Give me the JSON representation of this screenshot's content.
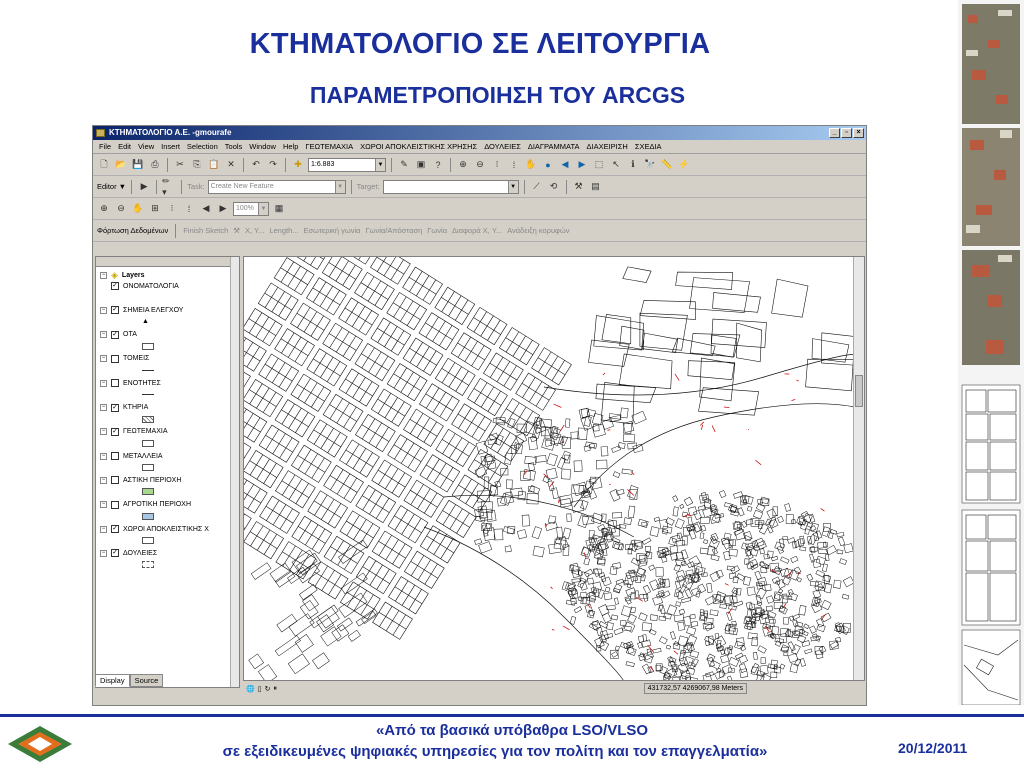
{
  "slide": {
    "title": "ΚΤΗΜΑΤΟΛΟΓΙΟ ΣΕ ΛΕΙΤΟΥΡΓΙΑ",
    "subtitle": "ΠΑΡΑΜΕΤΡΟΠΟΙΗΣΗ ΤΟΥ ARCGS",
    "footer_line1": "«Από τα βασικά υπόβαθρα LSO/VLSO",
    "footer_line2": "σε εξειδικευμένες ψηφιακές υπηρεσίες για τον πολίτη και τον επαγγελματία»",
    "date": "20/12/2011"
  },
  "window": {
    "title": "ΚΤΗΜΑΤΟΛΟΓΙΟ Α.Ε. -gmourafe",
    "menu": [
      "File",
      "Edit",
      "View",
      "Insert",
      "Selection",
      "Tools",
      "Window",
      "Help",
      "ΓΕΩΤΕΜΑΧΙΑ",
      "ΧΩΡΟΙ ΑΠΟΚΛΕΙΣΤΙΚΗΣ ΧΡΗΣΗΣ",
      "ΔΟΥΛΕΙΕΣ",
      "ΔΙΑΓΡΑΜΜΑΤΑ",
      "ΔΙΑΧΕΙΡΙΣΗ",
      "ΣΧΕΔΙΑ"
    ],
    "scale": "1:6.883",
    "editor_label": "Editor ▼",
    "task_label": "Task:",
    "task_value": "Create New Feature",
    "target_label": "Target:",
    "zoom_value": "100%",
    "custom_toolbar": [
      "Φόρτωση Δεδομένων",
      "Finish Sketch",
      "X, Y...",
      "Length...",
      "Εσωτερική γωνία",
      "Γωνία/Απόσταση",
      "Γωνία",
      "Διαφορά X, Y...",
      "Ανάδειξη κορυφών"
    ],
    "layers_root": "Layers",
    "layers": [
      {
        "name": "ΟΝΟΜΑΤΟΛΟΓΙΑ",
        "checked": true,
        "expand": "",
        "symbol": "none"
      },
      {
        "name": "ΣΗΜΕΙΑ ΕΛΕΓΧΟΥ",
        "checked": true,
        "expand": "−",
        "symbol": "triangle"
      },
      {
        "name": "ΟΤΑ",
        "checked": true,
        "expand": "−",
        "symbol": "box"
      },
      {
        "name": "ΤΟΜΕΙΣ",
        "checked": false,
        "expand": "−",
        "symbol": "line"
      },
      {
        "name": "ΕΝΟΤΗΤΕΣ",
        "checked": false,
        "expand": "−",
        "symbol": "line"
      },
      {
        "name": "ΚΤΗΡΙΑ",
        "checked": true,
        "expand": "−",
        "symbol": "hatch"
      },
      {
        "name": "ΓΕΩΤΕΜΑΧΙΑ",
        "checked": true,
        "expand": "−",
        "symbol": "box"
      },
      {
        "name": "ΜΕΤΑΛΛΕΙΑ",
        "checked": false,
        "expand": "−",
        "symbol": "box"
      },
      {
        "name": "ΑΣΤΙΚΗ ΠΕΡΙΟΧΗ",
        "checked": false,
        "expand": "−",
        "symbol": "green"
      },
      {
        "name": "ΑΓΡΟΤΙΚΗ ΠΕΡΙΟΧΗ",
        "checked": false,
        "expand": "−",
        "symbol": "blue"
      },
      {
        "name": "ΧΩΡΟΙ ΑΠΟΚΛΕΙΣΤΙΚΗΣ Χ",
        "checked": true,
        "expand": "−",
        "symbol": "box"
      },
      {
        "name": "ΔΟΥΛΕΙΕΣ",
        "checked": true,
        "expand": "−",
        "symbol": "dashed"
      }
    ],
    "tabs": [
      "Display",
      "Source"
    ],
    "coordinates": "431732,57  4269067,98 Meters"
  }
}
